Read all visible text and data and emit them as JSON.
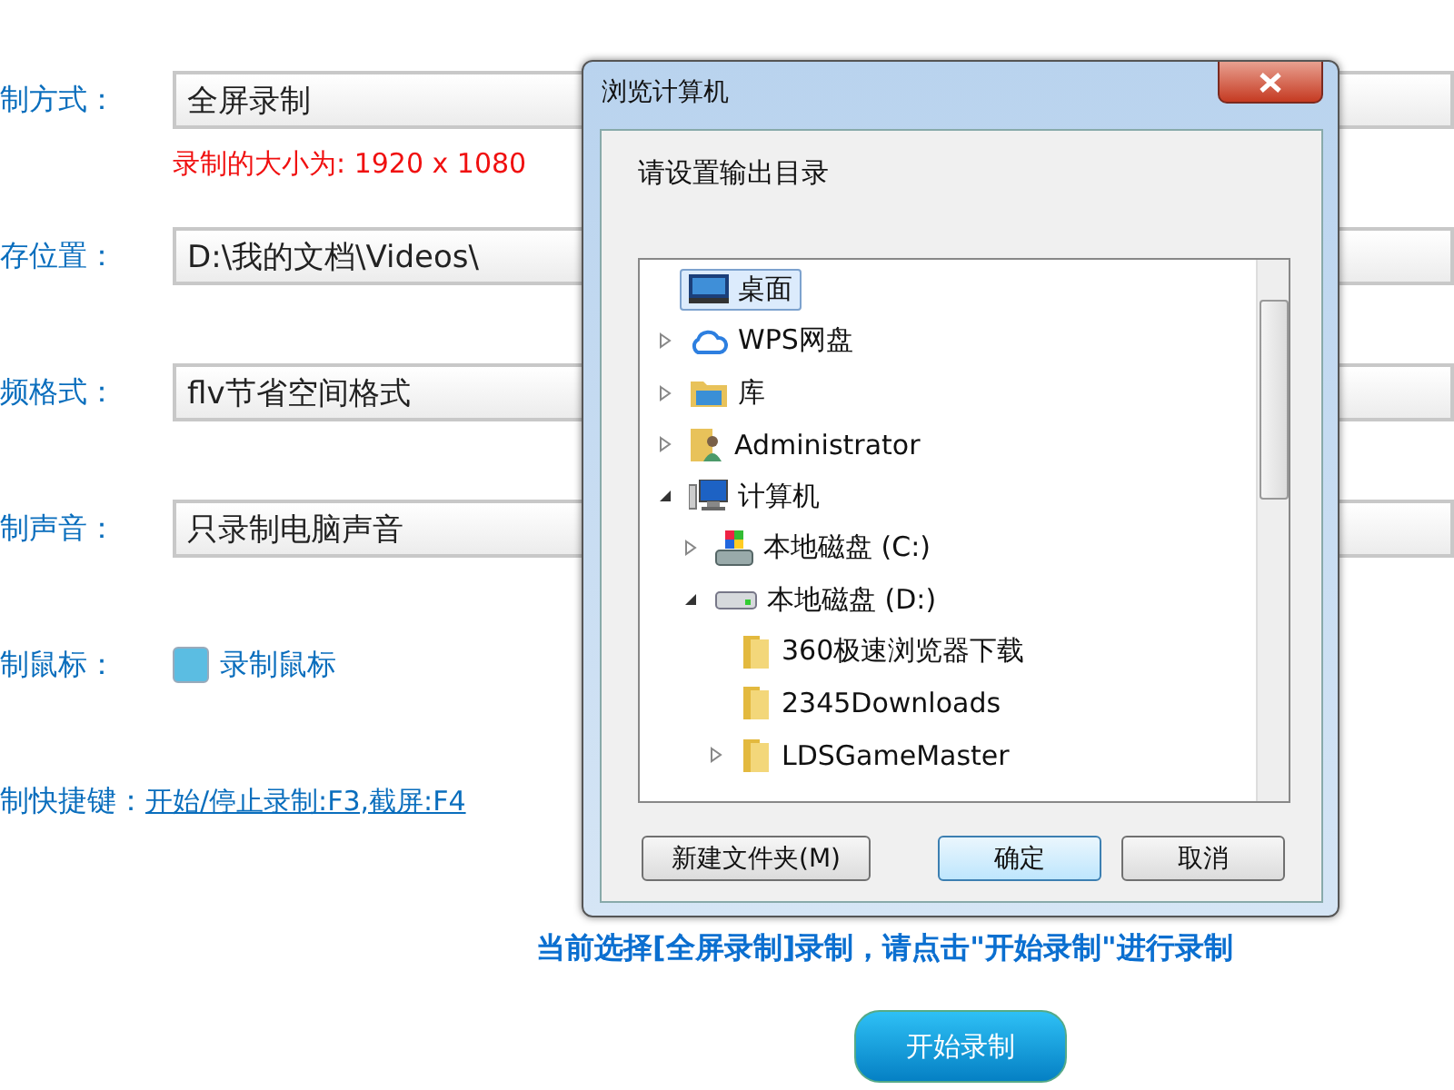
{
  "form": {
    "rows": [
      {
        "kind": "field",
        "label": "制方式：",
        "value": "全屏录制"
      },
      {
        "kind": "note",
        "text": "录制的大小为: 1920 x 1080"
      },
      {
        "kind": "field",
        "label": "存位置：",
        "value": "D:\\我的文档\\Videos\\"
      },
      {
        "kind": "field",
        "label": "频格式：",
        "value": "flv节省空间格式"
      },
      {
        "kind": "field",
        "label": "制声音：",
        "value": "只录制电脑声音"
      },
      {
        "kind": "checkbox",
        "label": "制鼠标：",
        "text": "录制鼠标",
        "checked": true
      },
      {
        "kind": "link",
        "label": "制快捷键：",
        "text": "开始/停止录制:F3,截屏:F4"
      }
    ],
    "message": "当前选择[全屏录制]录制，请点击\"开始录制\"进行录制",
    "start_button": "开始录制"
  },
  "dialog": {
    "title": "浏览计算机",
    "prompt": "请设置输出目录",
    "tree": [
      {
        "label": "桌面",
        "kind": "desktop",
        "selected": true,
        "expandable": false
      },
      {
        "label": "WPS网盘",
        "kind": "cloud",
        "selected": false,
        "expandable": true
      },
      {
        "label": "库",
        "kind": "library",
        "selected": false,
        "expandable": true
      },
      {
        "label": "Administrator",
        "kind": "user",
        "selected": false,
        "expandable": true
      },
      {
        "label": "计算机",
        "kind": "computer",
        "selected": false,
        "expandable": true,
        "expanded": true,
        "children": [
          {
            "label": "本地磁盘 (C:)",
            "kind": "sysdrive",
            "selected": false,
            "expandable": true
          },
          {
            "label": "本地磁盘 (D:)",
            "kind": "drive",
            "selected": false,
            "expandable": true,
            "expanded": true,
            "children": [
              {
                "label": "360极速浏览器下载",
                "kind": "folder",
                "selected": false,
                "expandable": false
              },
              {
                "label": "2345Downloads",
                "kind": "folder",
                "selected": false,
                "expandable": false
              },
              {
                "label": "LDSGameMaster",
                "kind": "folder",
                "selected": false,
                "expandable": true
              }
            ]
          }
        ]
      }
    ],
    "buttons": [
      {
        "label": "新建文件夹(M)",
        "default": false
      },
      {
        "label": "确定",
        "default": true
      },
      {
        "label": "取消",
        "default": false
      }
    ]
  }
}
